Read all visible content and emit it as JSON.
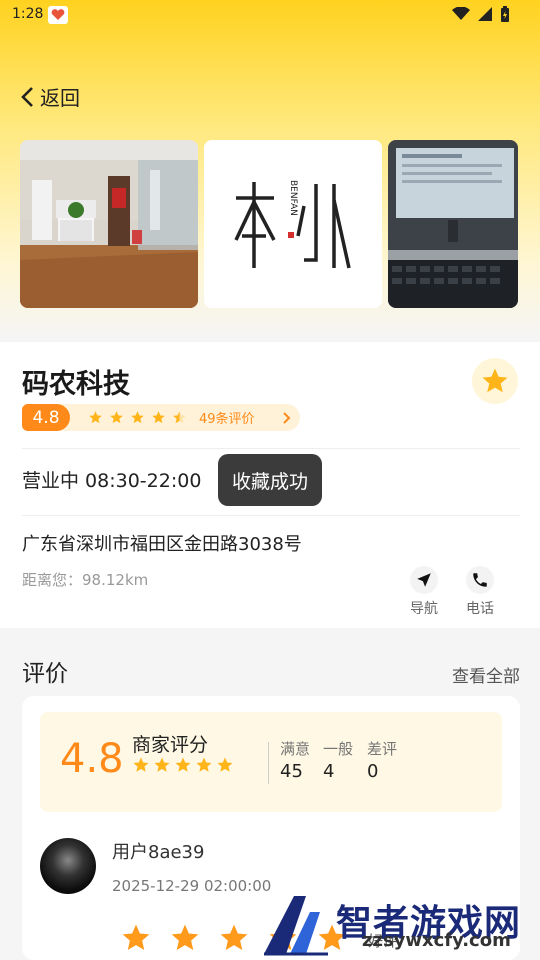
{
  "status": {
    "time": "1:28"
  },
  "nav": {
    "back_label": "返回"
  },
  "gallery": {
    "logo_text": "BENFAN"
  },
  "shop": {
    "name": "码农科技",
    "rating": "4.8",
    "review_count": "49条评价",
    "hours": "营业中 08:30-22:00",
    "toast": "收藏成功",
    "address": "广东省深圳市福田区金田路3038号",
    "distance": "距离您：98.12km",
    "nav_label": "导航",
    "phone_label": "电话"
  },
  "reviews": {
    "title": "评价",
    "see_all": "查看全部",
    "score": "4.8",
    "merchant_label": "商家评分",
    "stats": [
      {
        "label": "满意",
        "value": "45"
      },
      {
        "label": "一般",
        "value": "4"
      },
      {
        "label": "差评",
        "value": "0"
      }
    ],
    "item": {
      "user": "用户8ae39",
      "date": "2025-12-29 02:00:00",
      "rating_label": "好评",
      "stars": 5
    }
  },
  "watermark": {
    "title": "智者游戏网",
    "url": "zzsywxcfy.com"
  },
  "colors": {
    "accent": "#ff8a1a",
    "star": "#ffb51a",
    "header": "#ffd21f"
  }
}
